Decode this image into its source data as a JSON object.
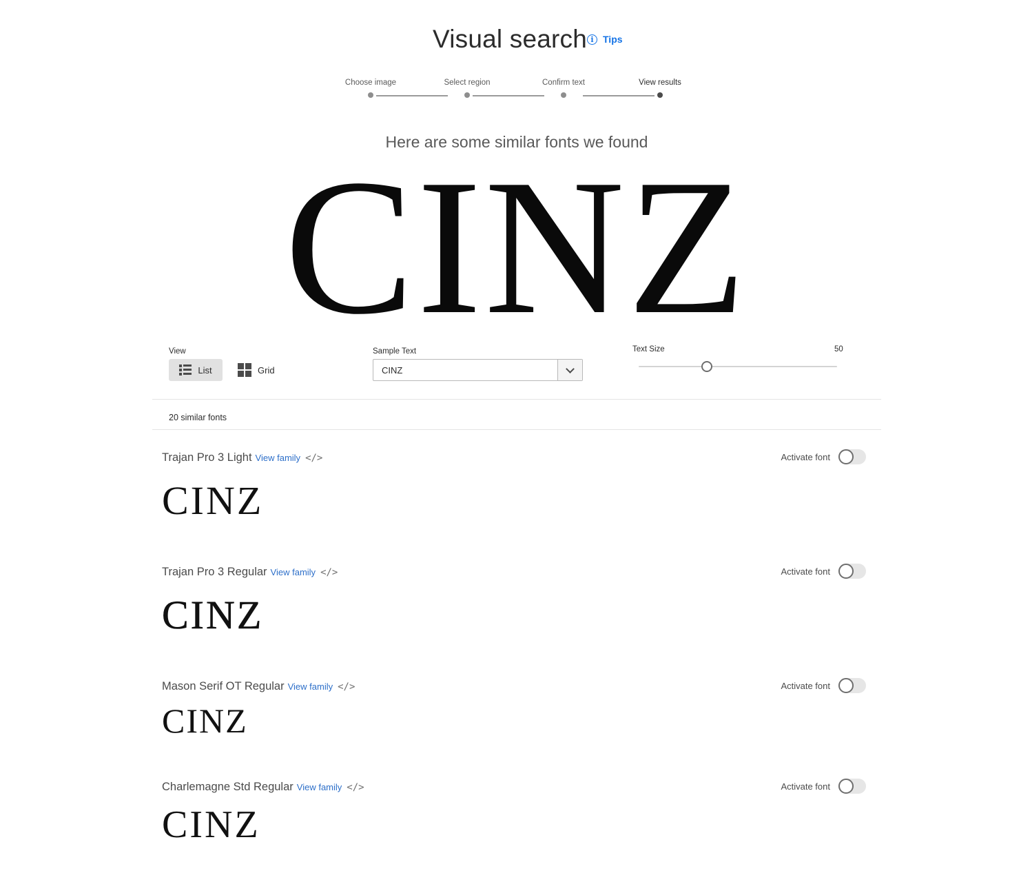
{
  "header": {
    "title": "Visual search",
    "tips_label": "Tips",
    "tips_icon": "info-icon"
  },
  "stepper": {
    "steps": [
      "Choose image",
      "Select region",
      "Confirm text",
      "View results"
    ],
    "current_step": 4
  },
  "subtitle": "Here are some similar fonts we found",
  "preview_text": "CINZ",
  "controls": {
    "view_label": "View",
    "list_label": "List",
    "grid_label": "Grid",
    "selected_view": "List",
    "sample_text_label": "Sample Text",
    "sample_text_value": "CINZ",
    "text_size_label": "Text Size",
    "text_size_value": "50"
  },
  "results_count": "20 similar fonts",
  "activate_label": "Activate font",
  "view_family_label": "View family",
  "code_icon": "</>",
  "fonts": [
    {
      "name": "Trajan Pro 3 Light",
      "sample": "CINZ",
      "active": false
    },
    {
      "name": "Trajan Pro 3 Regular",
      "sample": "CINZ",
      "active": false
    },
    {
      "name": "Mason Serif OT Regular",
      "sample": "CINZ",
      "active": false
    },
    {
      "name": "Charlemagne Std Regular",
      "sample": "CINZ",
      "active": false
    }
  ],
  "colors": {
    "accent": "#1473e6",
    "link": "#2d6fc9",
    "text": "#2c2c2c",
    "toggle_off": "#e6e6e6"
  }
}
